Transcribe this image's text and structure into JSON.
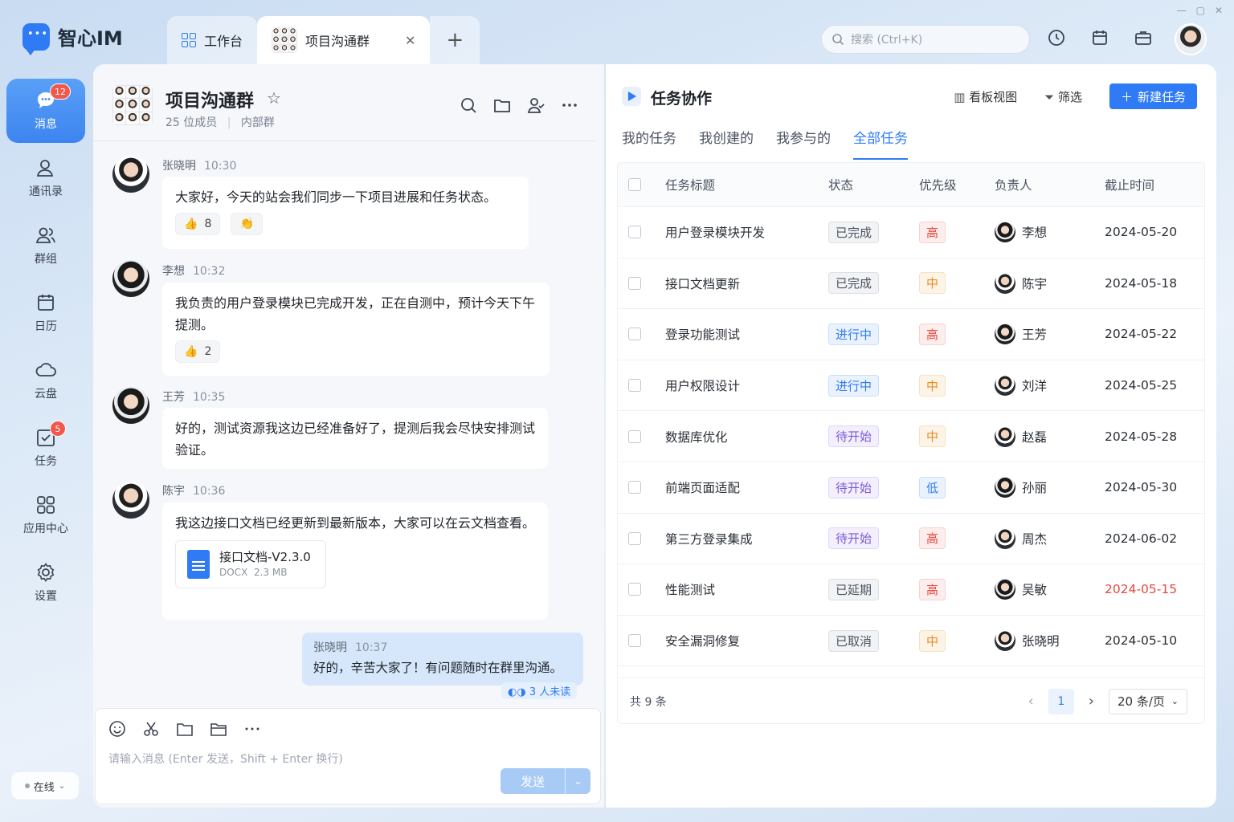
{
  "app": {
    "name": "智心IM"
  },
  "tabs": [
    {
      "label": "工作台",
      "icon": "grid-icon"
    },
    {
      "label": "项目沟通群",
      "icon": "group-avatar"
    }
  ],
  "search": {
    "placeholder": "搜索 (Ctrl+K)"
  },
  "nav": [
    {
      "label": "消息",
      "icon": "chat-bubble-icon",
      "badge": "12",
      "active": true
    },
    {
      "label": "通讯录",
      "icon": "contact-icon"
    },
    {
      "label": "群组",
      "icon": "group-icon"
    },
    {
      "label": "日历",
      "icon": "calendar-icon"
    },
    {
      "label": "云盘",
      "icon": "cloud-icon"
    },
    {
      "label": "任务",
      "icon": "task-check-icon",
      "badge": "5"
    },
    {
      "label": "应用中心",
      "icon": "apps-grid-icon"
    },
    {
      "label": "设置",
      "icon": "gear-icon"
    }
  ],
  "status": {
    "label": "在线"
  },
  "chat": {
    "title": "项目沟通群",
    "members": "25 位成员",
    "tag": "内部群",
    "messages": [
      {
        "sender": "张晓明",
        "time": "10:30",
        "text": "大家好，今天的站会我们同步一下项目进展和任务状态。",
        "reactions": [
          {
            "emoji": "👍",
            "count": "8"
          },
          {
            "emoji": "👏",
            "count": ""
          }
        ]
      },
      {
        "sender": "李想",
        "time": "10:32",
        "text": "我负责的用户登录模块已完成开发，正在自测中，预计今天下午提测。",
        "reactions": [
          {
            "emoji": "👍",
            "count": "2"
          }
        ]
      },
      {
        "sender": "王芳",
        "time": "10:35",
        "text": "好的，测试资源我这边已经准备好了，提测后我会尽快安排测试验证。"
      },
      {
        "sender": "陈宇",
        "time": "10:36",
        "text": "我这边接口文档已经更新到最新版本，大家可以在云文档查看。",
        "file": {
          "name": "接口文档-V2.3.0",
          "type": "DOCX",
          "size": "2.3 MB"
        }
      }
    ],
    "self": {
      "sender": "张晓明",
      "time": "10:37",
      "text": "好的，辛苦大家了！有问题随时在群里沟通。",
      "unread": "3 人未读"
    },
    "composer": {
      "placeholder": "请输入消息 (Enter 发送，Shift + Enter 换行)",
      "send": "发送"
    }
  },
  "task": {
    "title": "任务协作",
    "board_view": "看板视图",
    "filter": "筛选",
    "new_task": "新建任务",
    "subtabs": [
      "我的任务",
      "我创建的",
      "我参与的",
      "全部任务"
    ],
    "active_subtab": "全部任务",
    "columns": [
      "任务标题",
      "状态",
      "优先级",
      "负责人",
      "截止时间"
    ],
    "rows": [
      {
        "title": "用户登录模块开发",
        "status": "已完成",
        "priority": "高",
        "owner": "李想",
        "date": "2024-05-20"
      },
      {
        "title": "接口文档更新",
        "status": "已完成",
        "priority": "中",
        "owner": "陈宇",
        "date": "2024-05-18"
      },
      {
        "title": "登录功能测试",
        "status": "进行中",
        "priority": "高",
        "owner": "王芳",
        "date": "2024-05-22"
      },
      {
        "title": "用户权限设计",
        "status": "进行中",
        "priority": "中",
        "owner": "刘洋",
        "date": "2024-05-25"
      },
      {
        "title": "数据库优化",
        "status": "待开始",
        "priority": "中",
        "owner": "赵磊",
        "date": "2024-05-28"
      },
      {
        "title": "前端页面适配",
        "status": "待开始",
        "priority": "低",
        "owner": "孙丽",
        "date": "2024-05-30"
      },
      {
        "title": "第三方登录集成",
        "status": "待开始",
        "priority": "高",
        "owner": "周杰",
        "date": "2024-06-02"
      },
      {
        "title": "性能测试",
        "status": "已延期",
        "priority": "高",
        "owner": "吴敏",
        "date": "2024-05-15",
        "overdue": true
      },
      {
        "title": "安全漏洞修复",
        "status": "已取消",
        "priority": "中",
        "owner": "张晓明",
        "date": "2024-05-10"
      }
    ],
    "total": "共 9 条",
    "page": "1",
    "page_size": "20 条/页"
  },
  "colors": {
    "accent": "#2f7bf5",
    "danger": "#e4483f",
    "warning": "#ee8b1e",
    "purple": "#7c5bd6"
  }
}
